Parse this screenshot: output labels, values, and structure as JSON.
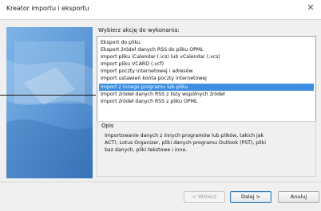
{
  "window": {
    "title": "Kreator importu i eksportu"
  },
  "prompt_label": "Wybierz akcję do wykonania:",
  "actions": [
    "Eksport do pliku",
    "Eksport źródeł danych RSS do pliku OPML",
    "Import pliku iCalendar (.ics) lub vCalendar (.vcs)",
    "Import pliku VCARD (.vcf)",
    "Import poczty internetowej i adresów",
    "Import ustawień konta poczty internetowej",
    "Import z innego programu lub pliku",
    "Import źródeł danych RSS z listy wspólnych źródeł",
    "Import źródeł danych RSS z pliku OPML"
  ],
  "selected_index": 6,
  "description": {
    "caption": "Opis",
    "text": "Importowanie danych z innych programów lub plików, takich jak ACT!, Lotus Organizer, pliki danych programu Outlook (PST), pliki baz danych, pliki tekstowe i inne."
  },
  "buttons": {
    "back": "< Wstecz",
    "next": "Dalej >",
    "cancel": "Anuluj"
  }
}
